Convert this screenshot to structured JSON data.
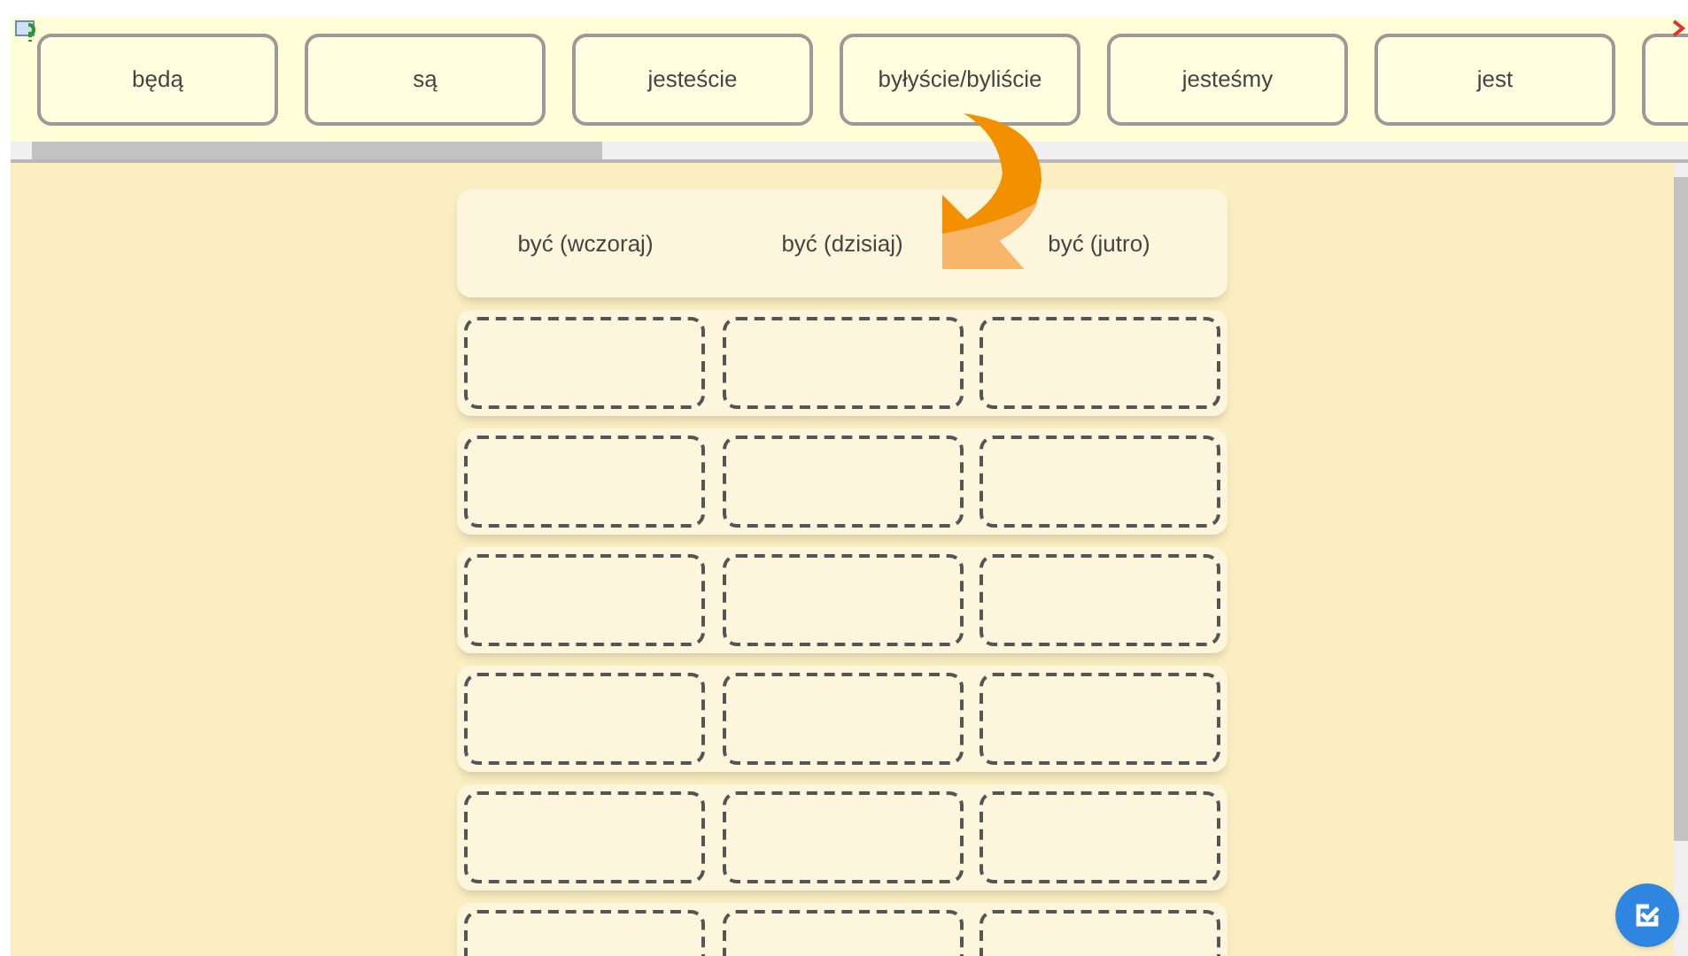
{
  "word_bank": [
    {
      "text": "będą"
    },
    {
      "text": "są"
    },
    {
      "text": "jesteście"
    },
    {
      "text": "byłyście/byliście"
    },
    {
      "text": "jesteśmy"
    },
    {
      "text": "jest"
    },
    {
      "kind": "cut_off"
    }
  ],
  "columns": [
    {
      "label": "być (wczoraj)"
    },
    {
      "label": "być (dzisiaj)"
    },
    {
      "label": "być (jutro)"
    }
  ],
  "rows": [
    {
      "cells": [
        {
          "kind": "empty"
        },
        {
          "kind": "empty"
        },
        {
          "kind": "empty"
        }
      ]
    },
    {
      "cells": [
        {
          "kind": "empty"
        },
        {
          "kind": "empty"
        },
        {
          "kind": "empty"
        }
      ]
    },
    {
      "cells": [
        {
          "kind": "empty"
        },
        {
          "kind": "empty"
        },
        {
          "kind": "empty"
        }
      ]
    },
    {
      "cells": [
        {
          "kind": "empty"
        },
        {
          "kind": "empty"
        },
        {
          "kind": "empty"
        }
      ]
    },
    {
      "cells": [
        {
          "kind": "empty"
        },
        {
          "kind": "empty"
        },
        {
          "kind": "empty"
        }
      ]
    },
    {
      "cells": [
        {
          "kind": "empty"
        },
        {
          "kind": "empty"
        },
        {
          "kind": "empty"
        }
      ]
    }
  ]
}
